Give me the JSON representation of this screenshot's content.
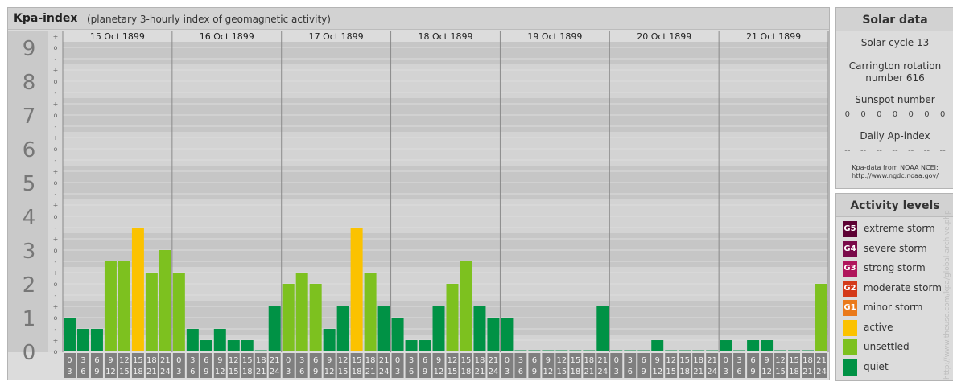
{
  "title": "Kpa-index",
  "subtitle": "(planetary 3-hourly index of geomagnetic activity)",
  "chart_data": {
    "type": "bar",
    "ylim": [
      0,
      9
    ],
    "y_ticks": [
      "0",
      "1",
      "2",
      "3",
      "4",
      "5",
      "6",
      "7",
      "8",
      "9"
    ],
    "sub_ticks": [
      "o",
      "+",
      "-"
    ],
    "days": [
      "15 Oct 1899",
      "16 Oct 1899",
      "17 Oct 1899",
      "18 Oct 1899",
      "19 Oct 1899",
      "20 Oct 1899",
      "21 Oct 1899"
    ],
    "interval_labels": [
      [
        "0",
        "3"
      ],
      [
        "3",
        "6"
      ],
      [
        "6",
        "9"
      ],
      [
        "9",
        "12"
      ],
      [
        "12",
        "15"
      ],
      [
        "15",
        "18"
      ],
      [
        "18",
        "21"
      ],
      [
        "21",
        "24"
      ]
    ],
    "values": [
      1.0,
      0.667,
      0.667,
      2.667,
      2.667,
      3.667,
      2.333,
      3.0,
      2.333,
      0.667,
      0.333,
      0.667,
      0.333,
      0.333,
      0.0,
      1.333,
      2.0,
      2.333,
      2.0,
      0.667,
      1.333,
      3.667,
      2.333,
      1.333,
      1.0,
      0.333,
      0.333,
      1.333,
      2.0,
      2.667,
      1.333,
      1.0,
      1.0,
      0.0,
      0.0,
      0.0,
      0.0,
      0.0,
      0.0,
      1.333,
      0.0,
      0.0,
      0.0,
      0.333,
      0.0,
      0.0,
      0.0,
      0.0,
      0.333,
      0.0,
      0.333,
      0.333,
      0.0,
      0.0,
      0.0,
      2.0
    ],
    "colors": {
      "quiet": "#009245",
      "unsettled": "#7dc11f",
      "active": "#fbc200"
    }
  },
  "solar": {
    "title": "Solar data",
    "cycle": "Solar cycle 13",
    "carrington_line1": "Carrington rotation",
    "carrington_line2": "number 616",
    "sunspot_label": "Sunspot number",
    "sunspot_values": [
      "0",
      "0",
      "0",
      "0",
      "0",
      "0",
      "0"
    ],
    "ap_label": "Daily Ap-index",
    "ap_values": [
      "--",
      "--",
      "--",
      "--",
      "--",
      "--",
      "--"
    ],
    "source_line1": "Kpa-data from NOAA NCEI:",
    "source_line2": "http://www.ngdc.noaa.gov/"
  },
  "activity": {
    "title": "Activity levels",
    "items": [
      {
        "code": "G5",
        "label": "extreme storm",
        "color": "#5c0033"
      },
      {
        "code": "G4",
        "label": "severe storm",
        "color": "#7a0a4a"
      },
      {
        "code": "G3",
        "label": "strong storm",
        "color": "#b0155c"
      },
      {
        "code": "G2",
        "label": "moderate storm",
        "color": "#d43a1a"
      },
      {
        "code": "G1",
        "label": "minor storm",
        "color": "#ea7a1a"
      },
      {
        "code": "",
        "label": "active",
        "color": "#fbc200"
      },
      {
        "code": "",
        "label": "unsettled",
        "color": "#7dc11f"
      },
      {
        "code": "",
        "label": "quiet",
        "color": "#009245"
      }
    ]
  },
  "credit": "http://www.theuse.com/kpa/global-archive.php"
}
